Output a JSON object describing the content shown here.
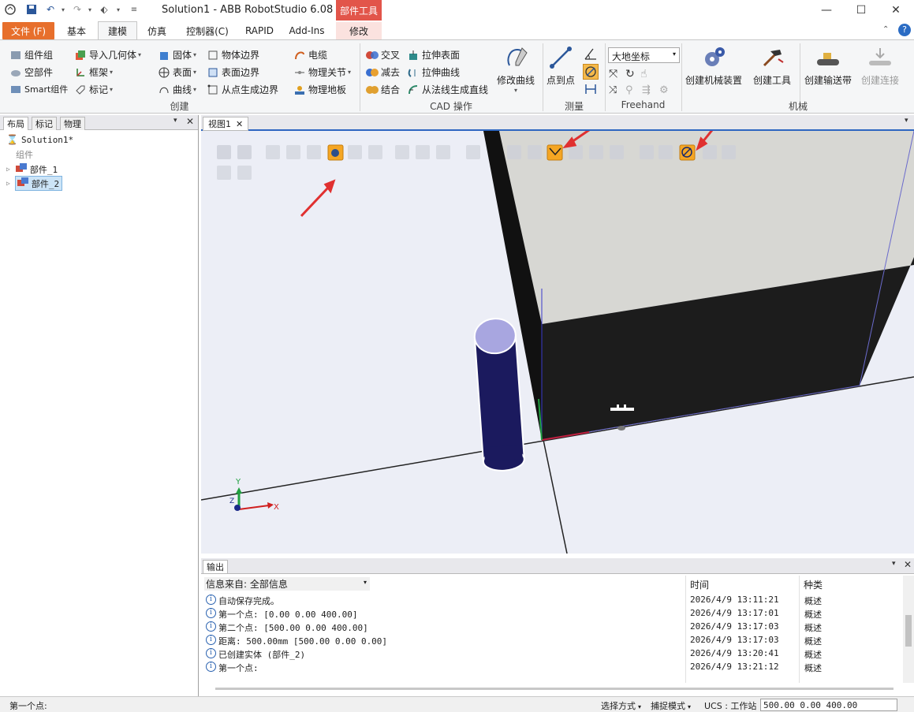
{
  "window": {
    "title": "Solution1 - ABB RobotStudio 6.08",
    "context_tab_title": "部件工具",
    "min": "—",
    "max": "☐",
    "close": "✕"
  },
  "tabs": {
    "file": "文件 (F)",
    "items": [
      "基本",
      "建模",
      "仿真",
      "控制器(C)",
      "RAPID",
      "Add-Ins",
      "修改"
    ],
    "active": "建模"
  },
  "ribbon": {
    "create": {
      "label": "创建",
      "col1": [
        "组件组",
        "空部件",
        "Smart组件"
      ],
      "col2": [
        "导入几何体",
        "框架",
        "标记"
      ],
      "col3": [
        "固体",
        "表面",
        "曲线"
      ],
      "col4": [
        "物体边界",
        "表面边界",
        "从点生成边界"
      ],
      "col5": [
        "电缆",
        "物理关节",
        "物理地板"
      ]
    },
    "cad": {
      "label": "CAD 操作",
      "col1": [
        "交叉",
        "减去",
        "结合"
      ],
      "col2": [
        "拉伸表面",
        "拉伸曲线",
        "从法线生成直线"
      ],
      "modify_curve": "修改曲线"
    },
    "measure": {
      "label": "测量",
      "point_to_point": "点到点"
    },
    "freehand": {
      "label": "Freehand",
      "coord_select": "大地坐标"
    },
    "machine": {
      "label": "机械",
      "create_mechanism": "创建机械装置",
      "create_tool": "创建工具",
      "create_conveyor": "创建输送带",
      "create_connection": "创建连接"
    }
  },
  "left_panel": {
    "tabs": [
      "布局",
      "标记",
      "物理"
    ],
    "tree": {
      "root": "Solution1*",
      "group": "组件",
      "items": [
        "部件_1",
        "部件_2"
      ]
    }
  },
  "viewport": {
    "tab": "视图1",
    "axis_x": "X",
    "axis_y": "Y",
    "axis_z": "Z"
  },
  "output": {
    "tab": "输出",
    "filter_label": "信息来自: 全部信息",
    "col_time": "时间",
    "col_type": "种类",
    "rows": [
      {
        "msg": "自动保存完成。",
        "time": "2026/4/9 13:11:21",
        "type": "概述"
      },
      {
        "msg": "第一个点: [0.00 0.00 400.00]",
        "time": "2026/4/9 13:17:01",
        "type": "概述"
      },
      {
        "msg": "第二个点: [500.00 0.00 400.00]",
        "time": "2026/4/9 13:17:03",
        "type": "概述"
      },
      {
        "msg": "距离: 500.00mm [500.00 0.00 0.00]",
        "time": "2026/4/9 13:17:03",
        "type": "概述"
      },
      {
        "msg": "已创建实体 (部件_2)",
        "time": "2026/4/9 13:20:41",
        "type": "概述"
      },
      {
        "msg": "第一个点:",
        "time": "2026/4/9 13:21:12",
        "type": "概述"
      }
    ]
  },
  "statusbar": {
    "message": "第一个点:",
    "select_mode": "选择方式",
    "snap_mode": "捕捉模式",
    "ucs": "UCS : 工作站",
    "coords": "500.00   0.00   400.00"
  },
  "colors": {
    "file_tab": "#e76f2c",
    "context_tab": "#e2554a",
    "highlight": "#f5a623",
    "box_top": "#d8d8d4",
    "box_front": "#1c1c1c",
    "cylinder": "#1b1a5e",
    "cylinder_top": "#a8a6e0"
  }
}
